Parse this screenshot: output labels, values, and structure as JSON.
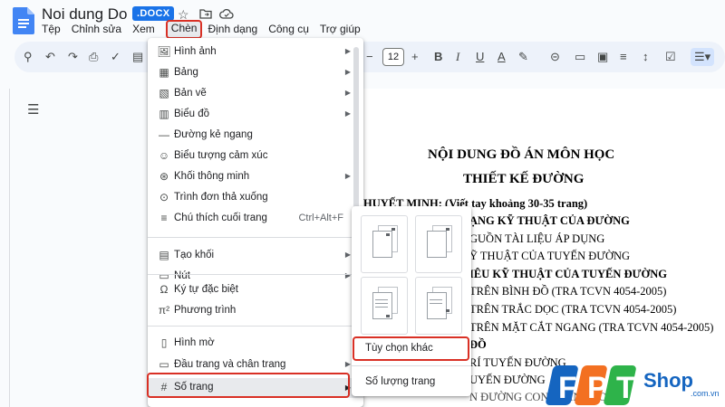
{
  "app": {
    "doc_title": "Noi dung Do an",
    "file_badge": ".DOCX"
  },
  "menubar": {
    "items": [
      "Tệp",
      "Chỉnh sửa",
      "Xem",
      "Chèn",
      "Định dạng",
      "Công cụ",
      "Trợ giúp"
    ],
    "active": "Chèn"
  },
  "toolbar": {
    "font_size": "12"
  },
  "insert_menu": {
    "items": [
      {
        "label": "Hình ảnh",
        "icon": "image-icon",
        "has_submenu": true
      },
      {
        "label": "Bảng",
        "icon": "table-icon",
        "has_submenu": true
      },
      {
        "label": "Bản vẽ",
        "icon": "drawing-icon",
        "has_submenu": true
      },
      {
        "label": "Biểu đồ",
        "icon": "chart-icon",
        "has_submenu": true
      },
      {
        "label": "Đường kẻ ngang",
        "icon": "horizontal-line-icon",
        "has_submenu": false
      },
      {
        "label": "Biểu tượng cảm xúc",
        "icon": "emoji-icon",
        "has_submenu": false
      },
      {
        "label": "Khối thông minh",
        "icon": "smart-chip-icon",
        "has_submenu": true
      },
      {
        "label": "Trình đơn thả xuống",
        "icon": "dropdown-icon",
        "has_submenu": false
      },
      {
        "label": "Chú thích cuối trang",
        "icon": "footnote-icon",
        "shortcut": "Ctrl+Alt+F"
      },
      {
        "label": "Tạo khối",
        "icon": "building-blocks-icon",
        "has_submenu": true
      },
      {
        "label": "Nút",
        "icon": "button-icon",
        "has_submenu": true
      },
      {
        "label": "Ký tự đặc biệt",
        "icon": "special-characters-icon",
        "has_submenu": false
      },
      {
        "label": "Phương trình",
        "icon": "equation-icon",
        "has_submenu": false
      },
      {
        "label": "Hình mờ",
        "icon": "watermark-icon",
        "has_submenu": false
      },
      {
        "label": "Đầu trang và chân trang",
        "icon": "header-footer-icon",
        "has_submenu": true
      },
      {
        "label": "Số trang",
        "icon": "hash-icon",
        "has_submenu": true
      }
    ]
  },
  "page_number_submenu": {
    "more_options": "Tùy chọn khác",
    "page_count": "Số lượng trang"
  },
  "document": {
    "title_1": "NỘI DUNG ĐỒ ÁN MÔN HỌC",
    "title_2": "THIẾT KẾ ĐƯỜNG",
    "lines": [
      {
        "text": "HUYẾT MINH: (Viết tay khoảng 30-35 trang)",
        "bold": true
      },
      {
        "text": "ẠNG KỸ THUẬT CỦA ĐƯỜNG",
        "bold": true
      },
      {
        "text": "GUỒN TÀI LIỆU ÁP DỤNG",
        "bold": false
      },
      {
        "text": "Ỹ THUẬT CỦA TUYẾN ĐƯỜNG",
        "bold": false
      },
      {
        "text": "IÊU KỸ THUẬT CỦA TUYẾN ĐƯỜNG",
        "bold": true
      },
      {
        "text": "TRÊN BÌNH ĐỒ (TRA TCVN 4054-2005)",
        "bold": false
      },
      {
        "text": "TRÊN TRẮC DỌC (TRA TCVN 4054-2005)",
        "bold": false
      },
      {
        "text": "TRÊN MẶT CẮT NGANG (TRA TCVN 4054-2005)",
        "bold": false
      },
      {
        "text": "ĐỒ",
        "bold": true
      },
      {
        "text": "RÍ TUYẾN ĐƯỜNG",
        "bold": false
      },
      {
        "text": "UYẾN ĐƯỜNG",
        "bold": false
      }
    ]
  },
  "watermark": {
    "brand": "FPT",
    "shop": "Shop",
    "domain": ".com.vn"
  },
  "colors": {
    "accent": "#1a73e8",
    "highlight_box": "#d93025",
    "fpt_blue": "#1565c0",
    "fpt_orange": "#f37021",
    "fpt_green": "#2eb34a"
  }
}
